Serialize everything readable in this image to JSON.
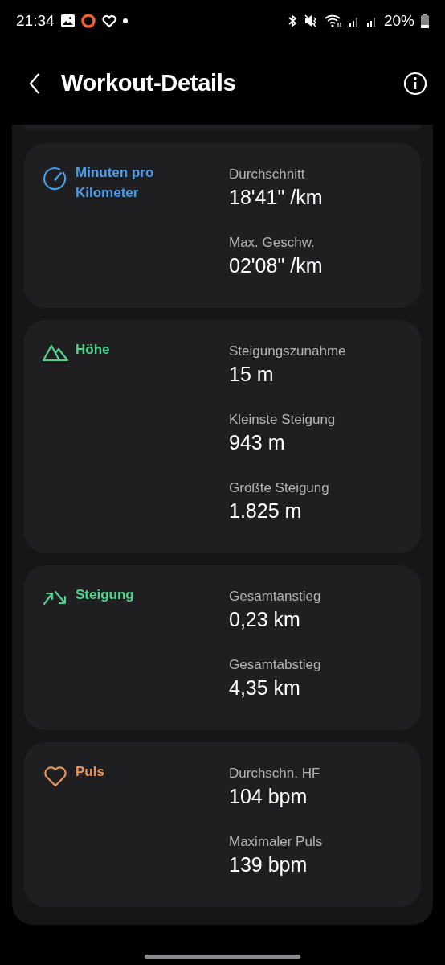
{
  "status_bar": {
    "time": "21:34",
    "battery": "20%"
  },
  "header": {
    "title": "Workout-Details"
  },
  "sections": [
    {
      "kind": "pace",
      "title": "Minuten pro Kilometer",
      "color": "#4a9ceb",
      "stats": [
        {
          "label": "Durchschnitt",
          "value": "18'41\" /km"
        },
        {
          "label": "Max. Geschw.",
          "value": "02'08\" /km"
        }
      ]
    },
    {
      "kind": "altitude",
      "title": "Höhe",
      "color": "#52d08e",
      "stats": [
        {
          "label": "Steigungszunahme",
          "value": "15 m"
        },
        {
          "label": "Kleinste Steigung",
          "value": "943 m"
        },
        {
          "label": "Größte Steigung",
          "value": "1.825 m"
        }
      ]
    },
    {
      "kind": "slope",
      "title": "Steigung",
      "color": "#52d08e",
      "stats": [
        {
          "label": "Gesamtanstieg",
          "value": "0,23 km"
        },
        {
          "label": "Gesamtabstieg",
          "value": "4,35 km"
        }
      ]
    },
    {
      "kind": "heart",
      "title": "Puls",
      "color": "#e8955a",
      "stats": [
        {
          "label": "Durchschn. HF",
          "value": "104 bpm"
        },
        {
          "label": "Maximaler Puls",
          "value": "139 bpm"
        }
      ]
    }
  ]
}
